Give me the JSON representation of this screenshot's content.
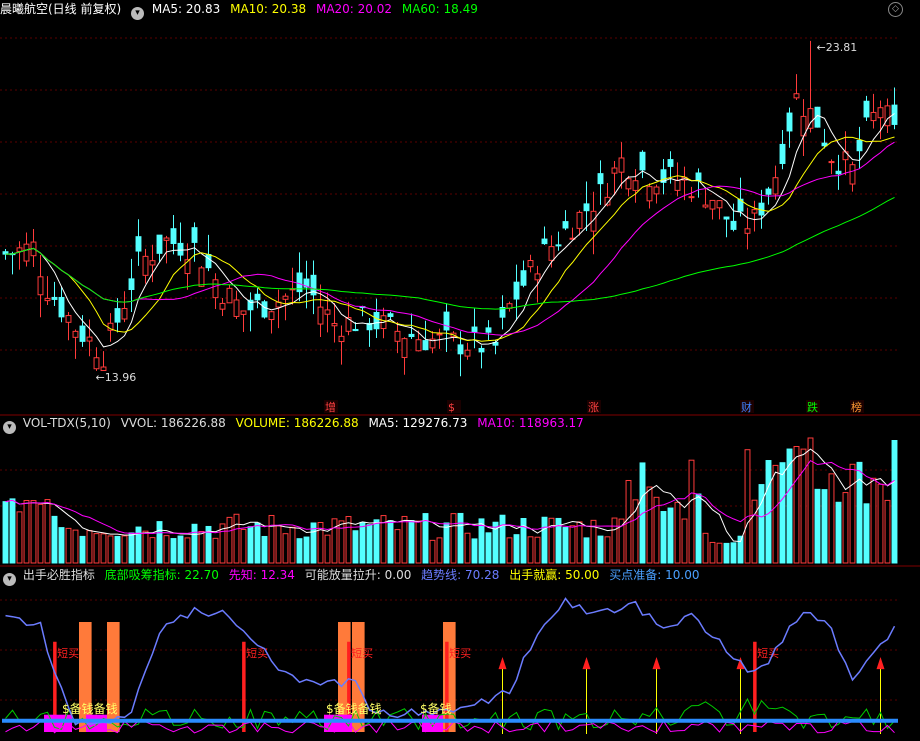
{
  "price_panel": {
    "title": "晨曦航空(日线 前复权)",
    "ma": [
      {
        "label": "MA5: 20.83",
        "color": "#ffffff"
      },
      {
        "label": "MA10: 20.38",
        "color": "#ffff00"
      },
      {
        "label": "MA20: 20.02",
        "color": "#ff00ff"
      },
      {
        "label": "MA60: 18.49",
        "color": "#00ff00"
      }
    ],
    "high_label": "23.81",
    "low_label": "13.96",
    "event_tags": [
      {
        "label": "增",
        "color": "#ff4040"
      },
      {
        "label": "$",
        "color": "#ff4040"
      },
      {
        "label": "涨",
        "color": "#ff4040"
      },
      {
        "label": "财",
        "color": "#4080ff"
      },
      {
        "label": "跌",
        "color": "#00ff00"
      },
      {
        "label": "榜",
        "color": "#ff9933"
      }
    ]
  },
  "volume_panel": {
    "title": "VOL-TDX(5,10)",
    "items": [
      {
        "label": "VVOL: 186226.88",
        "color": "#dddddd"
      },
      {
        "label": "VOLUME: 186226.88",
        "color": "#ffff00"
      },
      {
        "label": "MA5: 129276.73",
        "color": "#ffffff"
      },
      {
        "label": "MA10: 118963.17",
        "color": "#ff00ff"
      }
    ]
  },
  "indicator_panel": {
    "title": "出手必胜指标",
    "items": [
      {
        "label": "底部吸筹指标: 22.70",
        "color": "#00ff00"
      },
      {
        "label": "先知: 12.34",
        "color": "#ff00ff"
      },
      {
        "label": "可能放量拉升: 0.00",
        "color": "#dddddd"
      },
      {
        "label": "趋势线: 70.28",
        "color": "#6b7cff"
      },
      {
        "label": "出手就赢: 50.00",
        "color": "#ffff00"
      },
      {
        "label": "买点准备: 10.00",
        "color": "#4aa0ff"
      }
    ],
    "signal_label": "短买",
    "money_label_1": "$备钱备钱",
    "money_label_2": "$备钱备钱",
    "money_label_3": "$备钱"
  },
  "chart_data": {
    "type": "candlestick",
    "price_range": [
      13.0,
      24.5
    ],
    "price_high": 23.81,
    "price_low": 13.96,
    "indicator_range": [
      0,
      100
    ],
    "indicator_values": {
      "底部吸筹指标": 22.7,
      "先知": 12.34,
      "可能放量拉升": 0.0,
      "趋势线": 70.28,
      "出手就赢": 50.0,
      "买点准备": 10.0
    }
  },
  "colors": {
    "up": "#ff3b3b",
    "down": "#54ffff",
    "grid": "#5a0000",
    "ma5": "#ffffff",
    "ma10": "#ffff00",
    "ma20": "#ff00ff",
    "ma60": "#00ff00",
    "trend": "#6b7cff",
    "signal": "#ff2020",
    "bar_orange": "#ff7a3a",
    "base": "#2a8cff"
  },
  "icons": [
    "dropdown-icon",
    "settings-icon",
    "panel-dropdown-icon"
  ]
}
